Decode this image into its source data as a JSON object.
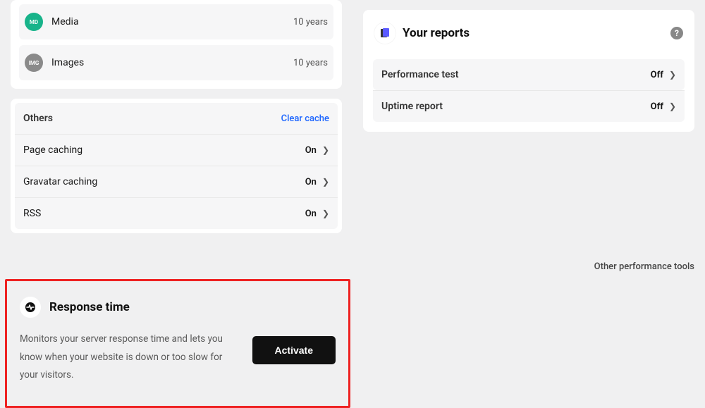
{
  "expiry": {
    "media": {
      "label": "Media",
      "value": "10 years",
      "badge": "MD"
    },
    "images": {
      "label": "Images",
      "value": "10 years",
      "badge": "IMG"
    }
  },
  "others": {
    "title": "Others",
    "clear": "Clear cache",
    "rows": [
      {
        "label": "Page caching",
        "value": "On"
      },
      {
        "label": "Gravatar caching",
        "value": "On"
      },
      {
        "label": "RSS",
        "value": "On"
      }
    ]
  },
  "reports": {
    "title": "Your reports",
    "rows": [
      {
        "label": "Performance test",
        "value": "Off"
      },
      {
        "label": "Uptime report",
        "value": "Off"
      }
    ]
  },
  "section_label": "Other performance tools",
  "response": {
    "title": "Response time",
    "desc": "Monitors your server response time and lets you know when your website is down or too slow for your visitors.",
    "button": "Activate"
  }
}
